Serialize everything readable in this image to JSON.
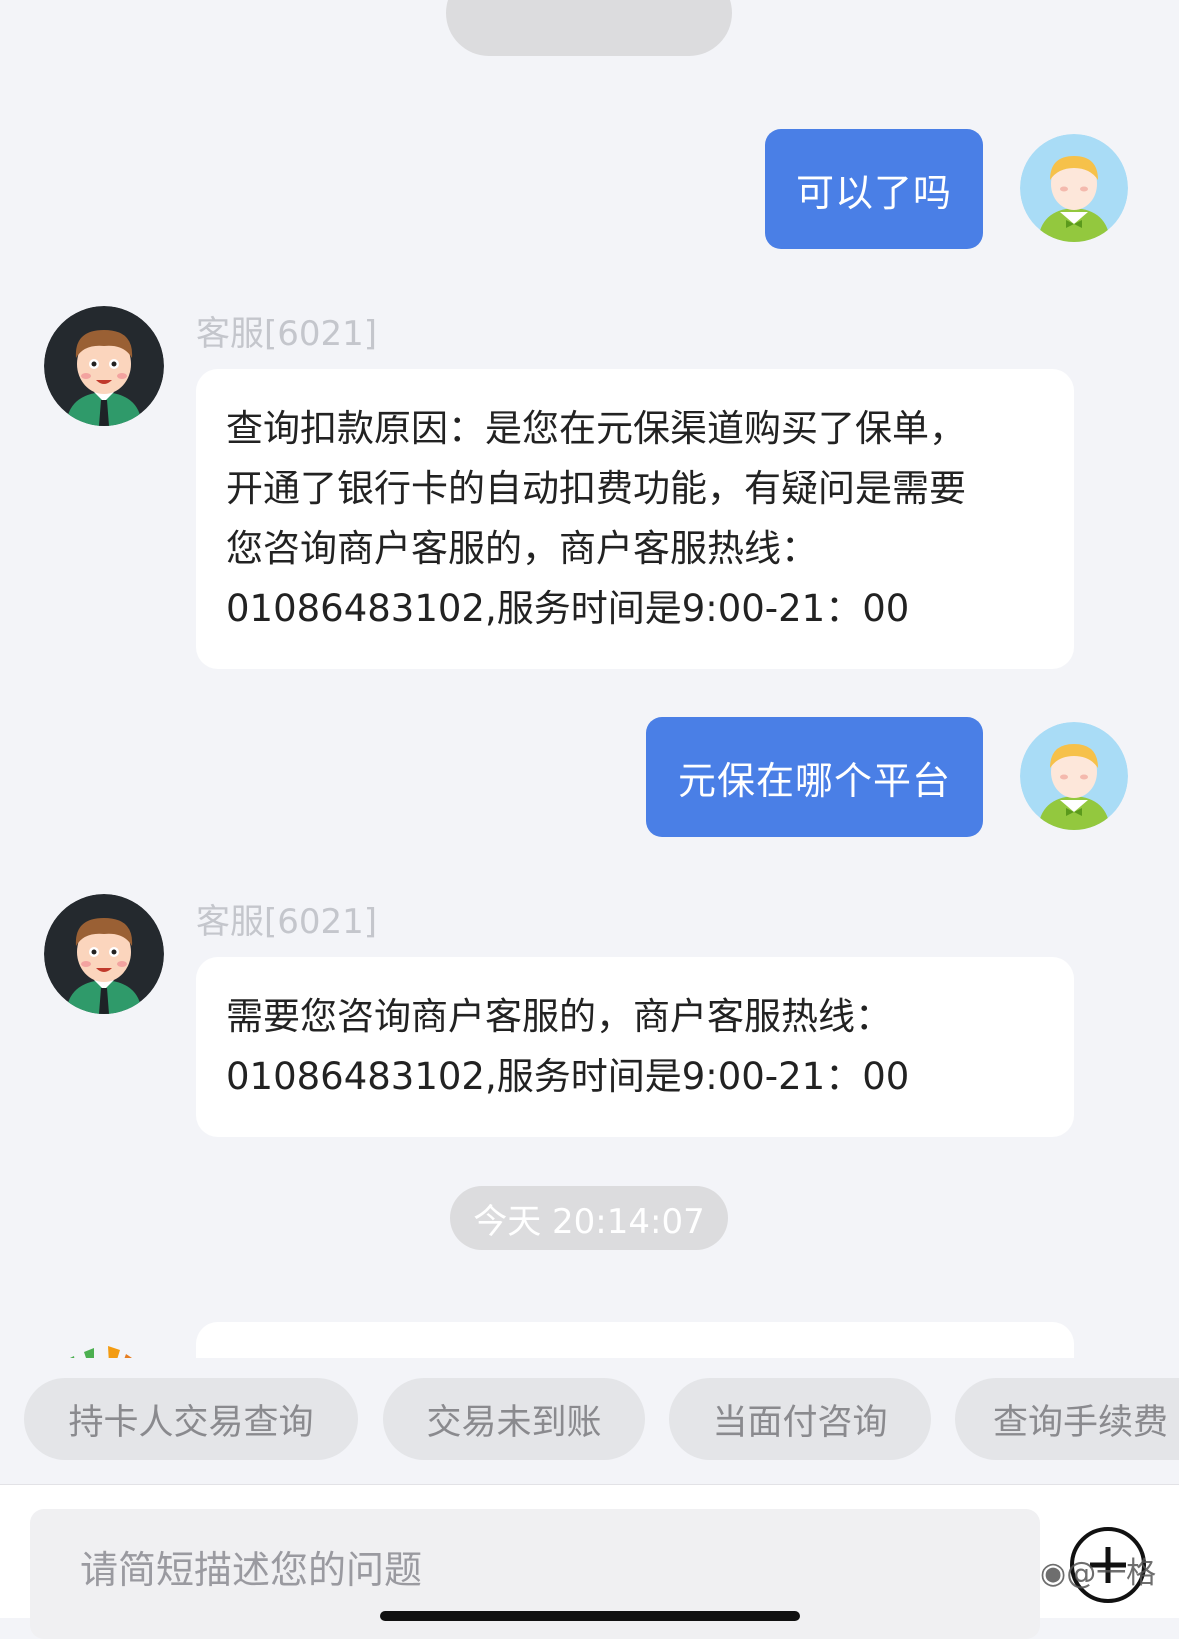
{
  "messages": [
    {
      "role": "user",
      "text": "可以了吗"
    },
    {
      "role": "agent",
      "sender": "客服[6021]",
      "lines": [
        "查询扣款原因：是您在元保渠道购买了保单，",
        "开通了银行卡的自动扣费功能，有疑问是需要",
        "您咨询商户客服的，商户客服热线：",
        "01086483102,服务时间是9:00-21：00"
      ]
    },
    {
      "role": "user",
      "text": "元保在哪个平台"
    },
    {
      "role": "agent",
      "sender": "客服[6021]",
      "lines": [
        "需要您咨询商户客服的，商户客服热线：",
        "01086483102,服务时间是9:00-21：00"
      ]
    }
  ],
  "timestamp": "今天 20:14:07",
  "quick_replies": [
    "持卡人交易查询",
    "交易未到账",
    "当面付咨询",
    "查询手续费"
  ],
  "input": {
    "placeholder": "请简短描述您的问题"
  },
  "watermark": "@一格",
  "colors": {
    "user_bubble": "#4a7fe6",
    "background": "#f3f4f8",
    "agent_bubble": "#ffffff"
  },
  "icons": {
    "user_avatar": "user-avatar-icon",
    "agent_avatar": "agent-avatar-icon",
    "add": "plus-circle-icon",
    "weibo": "weibo-icon"
  }
}
